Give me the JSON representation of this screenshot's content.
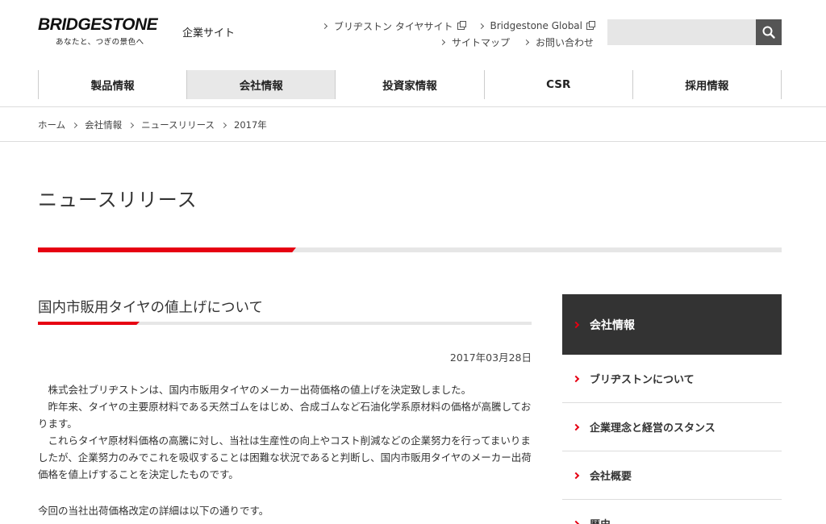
{
  "header": {
    "logo_text": "BRIDGESTONE",
    "logo_tagline": "あなたと、つぎの景色へ",
    "site_name": "企業サイト",
    "links_row1": [
      {
        "label": "ブリヂストン タイヤサイト",
        "external": true
      },
      {
        "label": "Bridgestone Global",
        "external": true
      }
    ],
    "links_row2": [
      {
        "label": "サイトマップ"
      },
      {
        "label": "お問い合わせ"
      }
    ],
    "search_placeholder": "",
    "search_icon": "search-icon"
  },
  "gnav": {
    "items": [
      "製品情報",
      "会社情報",
      "投資家情報",
      "CSR",
      "採用情報"
    ],
    "active_index": 1
  },
  "breadcrumb": [
    "ホーム",
    "会社情報",
    "ニュースリリース",
    "2017年"
  ],
  "page_title": "ニュースリリース",
  "article": {
    "title": "国内市販用タイヤの値上げについて",
    "date": "2017年03月28日",
    "paragraphs": [
      "株式会社ブリヂストンは、国内市販用タイヤのメーカー出荷価格の値上げを決定致しました。",
      "昨年来、タイヤの主要原材料である天然ゴムをはじめ、合成ゴムなど石油化学系原材料の価格が高騰しております。",
      "これらタイヤ原材料価格の高騰に対し、当社は生産性の向上やコスト削減などの企業努力を行ってまいりましたが、企業努力のみでこれを吸収することは困難な状況であると判断し、国内市販用タイヤのメーカー出荷価格を値上げすることを決定したものです。"
    ],
    "note": "今回の当社出荷価格改定の詳細は以下の通りです。"
  },
  "sidebar": {
    "heading": "会社情報",
    "items": [
      "ブリヂストンについて",
      "企業理念と経営のスタンス",
      "会社概要",
      "歴史"
    ]
  },
  "colors": {
    "accent": "#e60012",
    "sidebar_head": "#333333",
    "nav_active": "#e8e8e8"
  }
}
